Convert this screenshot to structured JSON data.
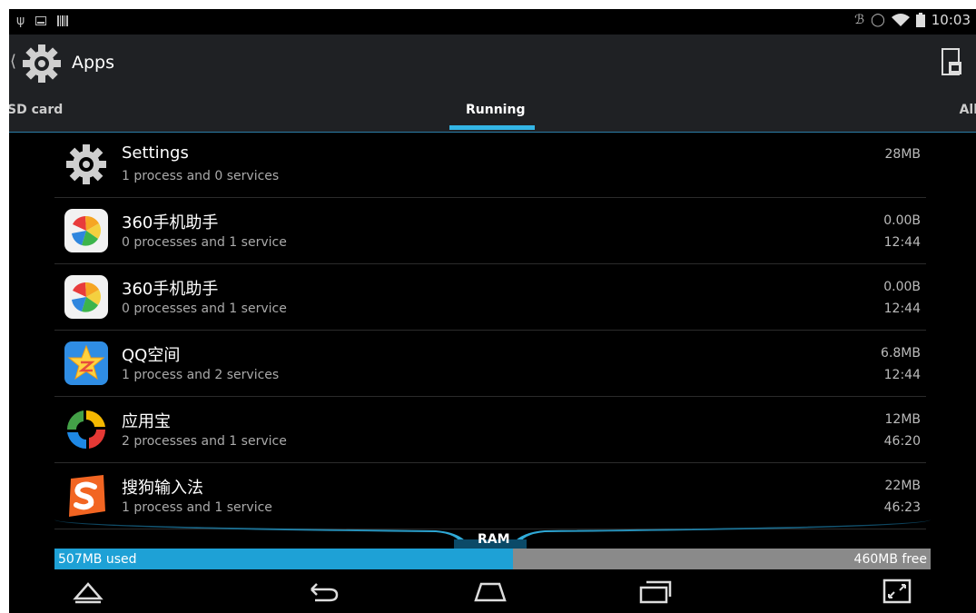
{
  "status_bar": {
    "time": "10:03",
    "left_icons": [
      "usb-icon",
      "screenshot-icon",
      "barcode-icon"
    ],
    "right_icons": [
      "bluetooth-icon",
      "alarm-icon",
      "wifi-icon",
      "battery-icon"
    ]
  },
  "action_bar": {
    "title": "Apps",
    "icon": "settings-gear-icon"
  },
  "tabs": [
    {
      "label": "SD card",
      "selected": false
    },
    {
      "label": "Running",
      "selected": true
    },
    {
      "label": "All",
      "selected": false
    }
  ],
  "apps": [
    {
      "name": "Settings",
      "desc": "1 process and 0 services",
      "size": "28MB",
      "time": "",
      "icon": "settings-gear-icon"
    },
    {
      "name": "360手机助手",
      "desc": "0 processes and 1 service",
      "size": "0.00B",
      "time": "12:44",
      "icon": "360-assistant-icon"
    },
    {
      "name": "360手机助手",
      "desc": "0 processes and 1 service",
      "size": "0.00B",
      "time": "12:44",
      "icon": "360-assistant-icon"
    },
    {
      "name": "QQ空间",
      "desc": "1 process and 2 services",
      "size": "6.8MB",
      "time": "12:44",
      "icon": "qzone-icon"
    },
    {
      "name": "应用宝",
      "desc": "2 processes and 1 service",
      "size": "12MB",
      "time": "46:20",
      "icon": "yingyongbao-icon"
    },
    {
      "name": "搜狗输入法",
      "desc": "1 process and 1 service",
      "size": "22MB",
      "time": "46:23",
      "icon": "sogou-input-icon"
    }
  ],
  "ram": {
    "label": "RAM",
    "used_label": "507MB used",
    "free_label": "460MB free",
    "used_fraction": 0.523
  },
  "nav": [
    "nav-home-up-icon",
    "back-icon",
    "home-icon",
    "recent-apps-icon",
    "fullscreen-icon"
  ],
  "colors": {
    "accent": "#33b5e5",
    "ram_used": "#1ea1d6",
    "ram_free": "#8a8a8a",
    "actionbar": "#1f2124"
  }
}
